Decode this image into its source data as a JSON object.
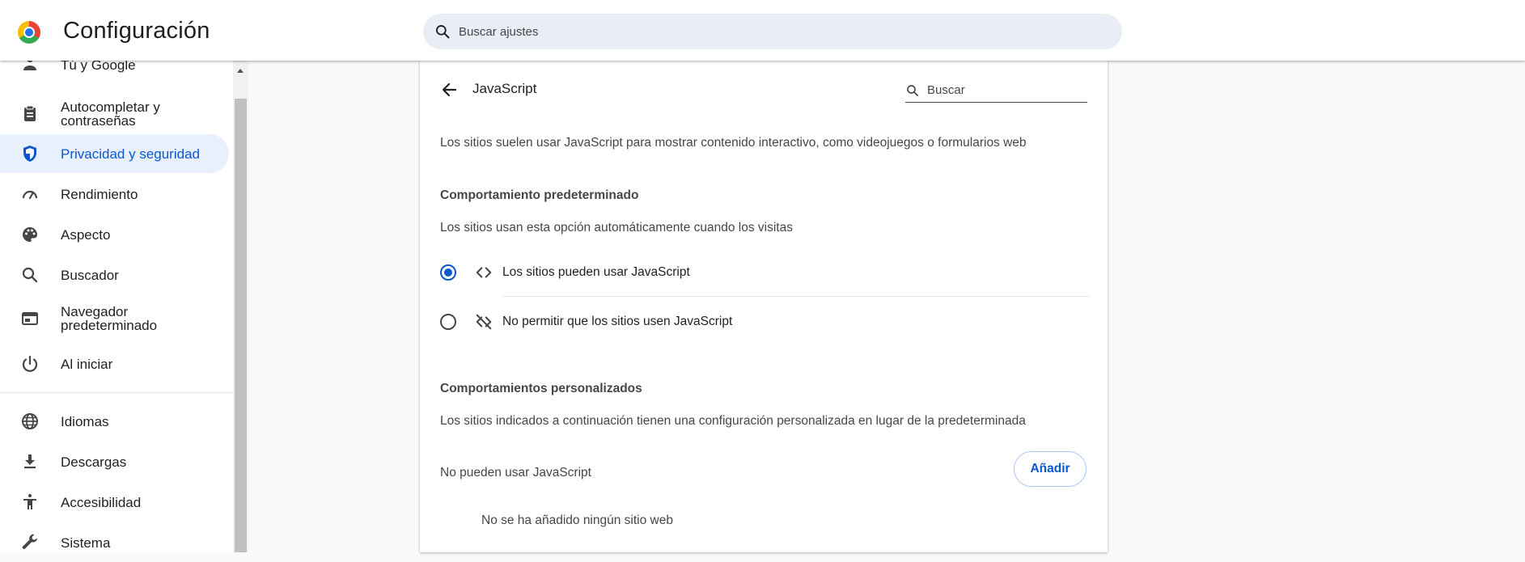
{
  "app": {
    "title": "Configuración",
    "search_placeholder": "Buscar ajustes"
  },
  "sidebar": {
    "items": [
      {
        "label": "Tú y Google",
        "icon": "person-icon"
      },
      {
        "label": "Autocompletar y contraseñas",
        "icon": "clipboard-icon"
      },
      {
        "label": "Privacidad y seguridad",
        "icon": "shield-icon",
        "active": true
      },
      {
        "label": "Rendimiento",
        "icon": "speedometer-icon"
      },
      {
        "label": "Aspecto",
        "icon": "palette-icon"
      },
      {
        "label": "Buscador",
        "icon": "search-icon"
      },
      {
        "label": "Navegador predeterminado",
        "icon": "browser-icon"
      },
      {
        "label": "Al iniciar",
        "icon": "power-icon"
      },
      {
        "label": "Idiomas",
        "icon": "globe-icon"
      },
      {
        "label": "Descargas",
        "icon": "download-icon"
      },
      {
        "label": "Accesibilidad",
        "icon": "accessibility-icon"
      },
      {
        "label": "Sistema",
        "icon": "wrench-icon"
      }
    ]
  },
  "page": {
    "title": "JavaScript",
    "search_placeholder": "Buscar",
    "description": "Los sitios suelen usar JavaScript para mostrar contenido interactivo, como videojuegos o formularios web",
    "default_heading": "Comportamiento predeterminado",
    "default_subtext": "Los sitios usan esta opción automáticamente cuando los visitas",
    "options": [
      {
        "label": "Los sitios pueden usar JavaScript",
        "icon": "code-icon",
        "selected": true
      },
      {
        "label": "No permitir que los sitios usen JavaScript",
        "icon": "code-off-icon",
        "selected": false
      }
    ],
    "custom_heading": "Comportamientos personalizados",
    "custom_subtext": "Los sitios indicados a continuación tienen una configuración personalizada en lugar de la predeterminada",
    "blocked_label": "No pueden usar JavaScript",
    "add_button": "Añadir",
    "empty_text": "No se ha añadido ningún sitio web"
  },
  "colors": {
    "accent": "#0b57d0",
    "active_nav_bg": "#e8f0fe",
    "search_bg": "#e9eef6"
  }
}
